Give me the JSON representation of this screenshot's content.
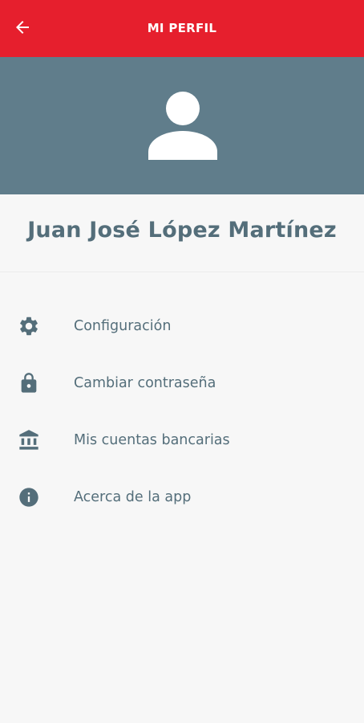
{
  "app_bar": {
    "title": "MI PERFIL",
    "back_icon": "arrow-back-icon",
    "color": "#e61f2d"
  },
  "profile": {
    "avatar_icon": "person-icon",
    "name": "Juan José López Martínez",
    "header_color": "#607d8b"
  },
  "menu": {
    "items": [
      {
        "label": "Configuración",
        "icon": "gear-icon"
      },
      {
        "label": "Cambiar contraseña",
        "icon": "lock-icon"
      },
      {
        "label": "Mis cuentas bancarias",
        "icon": "bank-icon"
      },
      {
        "label": "Acerca de la app",
        "icon": "info-icon"
      }
    ],
    "text_color": "#546e7a"
  }
}
